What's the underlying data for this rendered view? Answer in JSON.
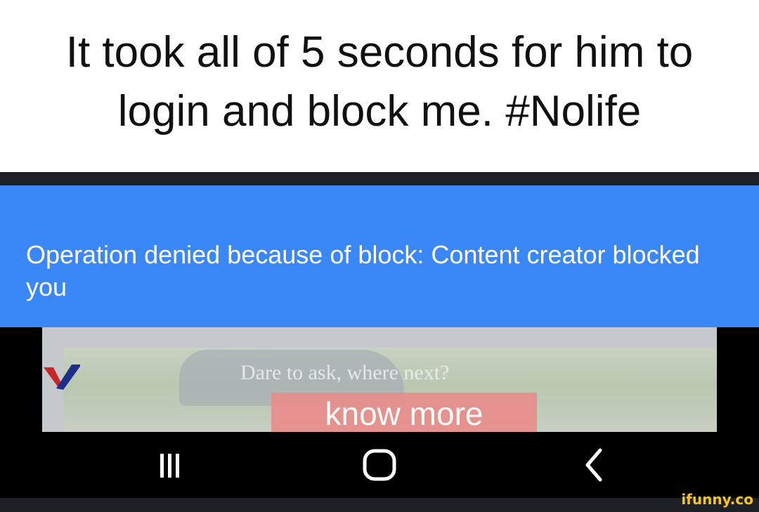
{
  "caption": {
    "text": "It took all of 5 seconds for him to login and block me. #Nolife"
  },
  "snackbar": {
    "message": "Operation denied because of block: Content creator blocked you",
    "color": "#3a87f7"
  },
  "ad": {
    "tagline": "Dare to ask, where next?",
    "button_label": "know more",
    "logo_icon": "v-logo-icon",
    "button_color": "#e88e8c"
  },
  "navbar": {
    "recents_icon": "recent-apps-icon",
    "home_icon": "home-icon",
    "back_icon": "back-icon"
  },
  "watermark": {
    "text": "ifunny.co",
    "color": "#f5c518"
  }
}
